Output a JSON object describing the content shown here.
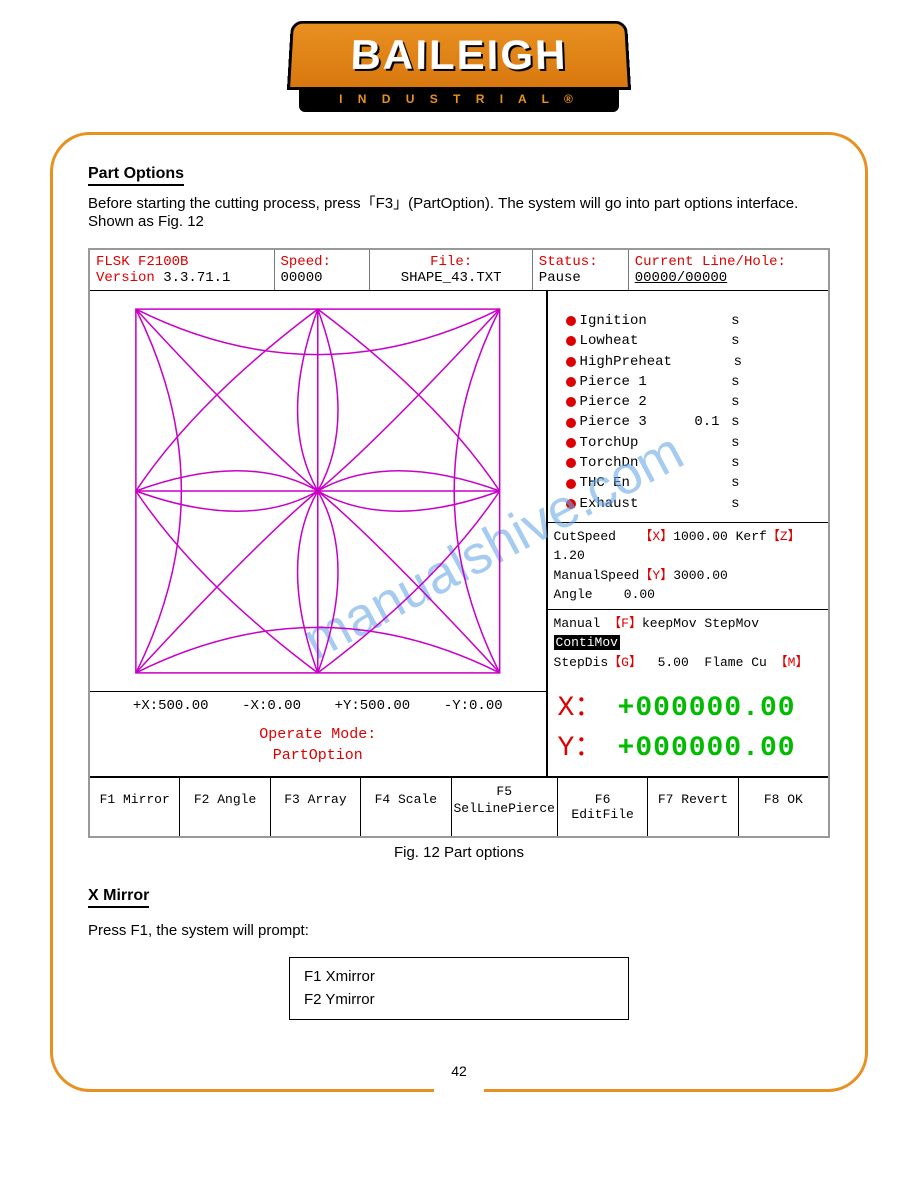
{
  "logo": {
    "name": "BAILEIGH",
    "sub": "I N D U S T R I A L ®"
  },
  "section": {
    "title": "Part Options",
    "text": "Before starting the cutting process, press「F3」(PartOption). The system will go into part options interface. Shown as Fig. 12"
  },
  "screen": {
    "header": {
      "model_label": "FLSK F2100B",
      "version_label": "Version",
      "version_val": "3.3.71.1",
      "speed_label": "Speed:",
      "speed_val": "00000",
      "file_label": "File:",
      "file_val": "SHAPE_43.TXT",
      "status_label": "Status:",
      "status_val": "Pause",
      "line_label": "Current Line/Hole:",
      "line_val": "00000/00000"
    },
    "coords": {
      "xp": "+X:500.00",
      "xm": "-X:0.00",
      "yp": "+Y:500.00",
      "ym": "-Y:0.00"
    },
    "opmode": {
      "t1": "Operate Mode:",
      "t2": "PartOption"
    },
    "status": [
      {
        "lab": "Ignition",
        "val": "",
        "u": "s"
      },
      {
        "lab": "Lowheat",
        "val": "",
        "u": "s"
      },
      {
        "lab": "HighPreheat",
        "val": "",
        "u": "s"
      },
      {
        "lab": "Pierce 1",
        "val": "",
        "u": "s"
      },
      {
        "lab": "Pierce 2",
        "val": "",
        "u": "s"
      },
      {
        "lab": "Pierce 3",
        "val": "0.1",
        "u": "s"
      },
      {
        "lab": "TorchUp",
        "val": "",
        "u": "s"
      },
      {
        "lab": "TorchDn",
        "val": "",
        "u": "s"
      },
      {
        "lab": "THC En",
        "val": "",
        "u": "s"
      },
      {
        "lab": "Exhaust",
        "val": "",
        "u": "s"
      }
    ],
    "params": {
      "r1": {
        "a": "CutSpeed",
        "k": "【X】",
        "b": "1000.00",
        "c": "Kerf",
        "k2": "【Z】",
        "d": "1.20"
      },
      "r2": {
        "a": "ManualSpeed",
        "k": "【Y】",
        "b": "3000.00",
        "c": "Angle",
        "d": "0.00"
      },
      "r3": {
        "a": "Manual",
        "k": "【F】",
        "b": "keepMov StepMov",
        "badge": "ContiMov"
      },
      "r4": {
        "a": "StepDis",
        "k": "【G】",
        "b": "5.00",
        "c": "Flame Cu",
        "k2": "【M】"
      }
    },
    "dro": {
      "x_lab": "X：",
      "x_val": "+000000.00",
      "y_lab": "Y：",
      "y_val": "+000000.00"
    },
    "fkeys": [
      "F1 Mirror",
      "F2 Angle",
      "F3 Array",
      "F4 Scale",
      "F5\nSelLinePierce",
      "F6 EditFile",
      "F7 Revert",
      "F8 OK"
    ],
    "caption": "Fig. 12 Part options"
  },
  "mirror": {
    "title": "X Mirror",
    "text": "Press F1, the system will prompt:",
    "box": {
      "l1": "F1  Xmirror",
      "l2": "F2  Ymirror"
    }
  },
  "page_num": "42",
  "watermark": "manualshive.com"
}
